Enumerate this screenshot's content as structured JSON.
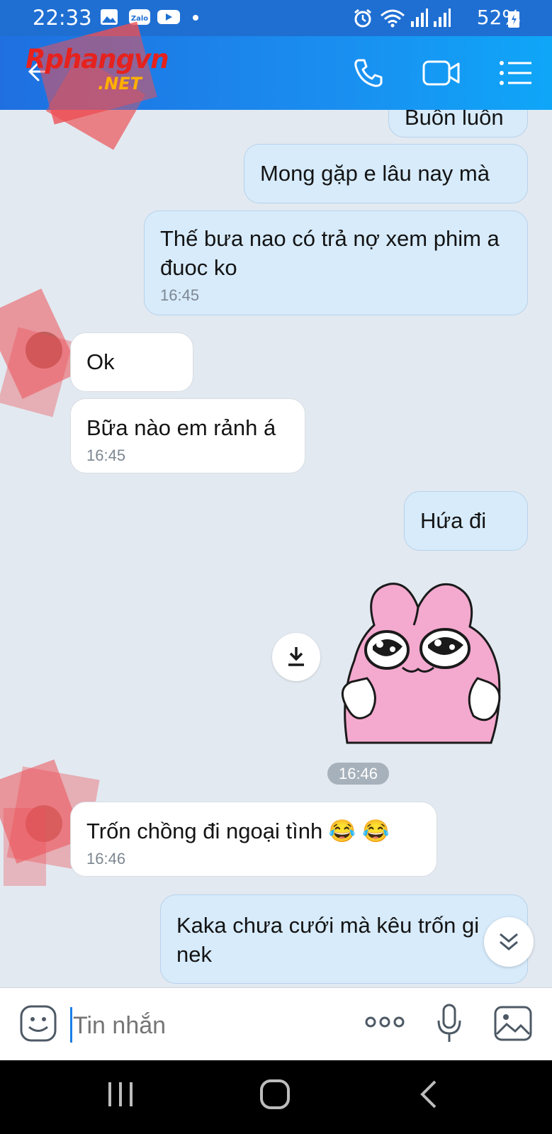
{
  "status_bar": {
    "time": "22:33",
    "battery": "52%"
  },
  "header": {
    "watermark_brand": "Rphangvn",
    "watermark_domain": ".NET"
  },
  "messages": [
    {
      "text": "Buồn luôn",
      "sender": "me"
    },
    {
      "text": "Mong gặp e lâu nay mà",
      "sender": "me"
    },
    {
      "text": "Thế bưa nao có trả nợ xem phim a đuoc ko",
      "time": "16:45",
      "sender": "me"
    },
    {
      "text": "Ok",
      "sender": "contact"
    },
    {
      "text": "Bữa nào em rảnh á",
      "time": "16:45",
      "sender": "contact"
    },
    {
      "text": "Hứa đi",
      "sender": "me"
    },
    {
      "text": "Trốn chồng đi ngoại tình 😂 😂",
      "time": "16:46",
      "sender": "contact"
    },
    {
      "text": "Kaka chưa cưới mà kêu trốn gi nek",
      "sender": "me"
    }
  ],
  "sticker_time": "16:46",
  "input": {
    "placeholder": "Tin nhắn"
  },
  "icons": {
    "back": "back-arrow-icon",
    "call": "phone-icon",
    "video": "video-call-icon",
    "menu": "list-menu-icon",
    "download": "download-icon",
    "scroll": "double-chevron-down-icon",
    "emoji": "emoji-icon",
    "more": "more-dots-icon",
    "mic": "microphone-icon",
    "gallery": "image-gallery-icon"
  },
  "colors": {
    "header": "#1a8ef0",
    "outgoing_bubble": "#d7ebfb",
    "incoming_bubble": "#ffffff",
    "background": "#e2e9f1"
  }
}
